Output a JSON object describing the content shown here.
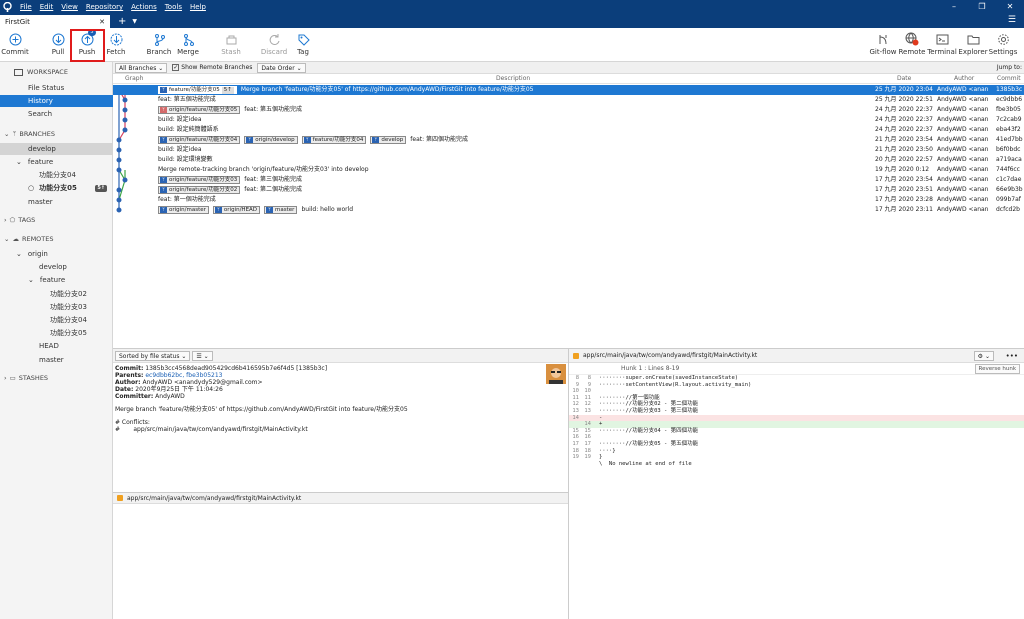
{
  "menu": {
    "items": [
      "File",
      "Edit",
      "View",
      "Repository",
      "Actions",
      "Tools",
      "Help"
    ]
  },
  "window": {
    "minimize": "–",
    "maximize": "❐",
    "close": "✕"
  },
  "tabs": [
    {
      "label": "FirstGit",
      "close": "✕"
    }
  ],
  "toolbar": {
    "commit": "Commit",
    "pull": "Pull",
    "push": "Push",
    "push_badge": "5",
    "fetch": "Fetch",
    "branch": "Branch",
    "merge": "Merge",
    "stash": "Stash",
    "discard": "Discard",
    "tag": "Tag",
    "gitflow": "Git-flow",
    "remote": "Remote",
    "terminal": "Terminal",
    "explorer": "Explorer",
    "settings": "Settings"
  },
  "sidebar": {
    "workspace": "WORKSPACE",
    "file_status": "File Status",
    "history": "History",
    "search": "Search",
    "branches": "BRANCHES",
    "develop": "develop",
    "feature": "feature",
    "f04": "功能分支04",
    "f05": "功能分支05",
    "f05_ahead": "5↑",
    "master": "master",
    "tags": "TAGS",
    "remotes": "REMOTES",
    "origin": "origin",
    "r_develop": "develop",
    "r_feature": "feature",
    "r_f02": "功能分支02",
    "r_f03": "功能分支03",
    "r_f04": "功能分支04",
    "r_f05": "功能分支05",
    "r_head": "HEAD",
    "r_master": "master",
    "stashes": "STASHES"
  },
  "filters": {
    "branches": "All Branches ⌄",
    "show_remote": "Show Remote Branches",
    "order": "Date Order ⌄",
    "jump": "Jump to:"
  },
  "columns": {
    "graph": "Graph",
    "description": "Description",
    "date": "Date",
    "author": "Author",
    "commit": "Commit"
  },
  "commits": [
    {
      "tags": [
        {
          "name": "feature/功能分支05",
          "cur": true,
          "ahead": "5↑"
        }
      ],
      "msg": "Merge branch 'feature/功能分支05' of https://github.com/AndyAWD/FirstGit into feature/功能分支05",
      "date": "25 九月 2020 23:04",
      "author": "AndyAWD <anan",
      "commit": "1385b3c"
    },
    {
      "tags": [],
      "msg": "feat: 第五個功能完成",
      "date": "25 九月 2020 22:51",
      "author": "AndyAWD <anan",
      "commit": "ec9dbb6"
    },
    {
      "tags": [
        {
          "name": "origin/feature/功能分支05",
          "remote": true
        }
      ],
      "msg": "feat: 第五個功能完成",
      "date": "24 九月 2020 22:37",
      "author": "AndyAWD <anan",
      "commit": "fbe3b05"
    },
    {
      "tags": [],
      "msg": "build: 設定idea",
      "date": "24 九月 2020 22:37",
      "author": "AndyAWD <anan",
      "commit": "7c2cab9"
    },
    {
      "tags": [],
      "msg": "build: 設定純簡體語系",
      "date": "24 九月 2020 22:37",
      "author": "AndyAWD <anan",
      "commit": "eba43f2"
    },
    {
      "tags": [
        {
          "name": "origin/feature/功能分支04"
        },
        {
          "name": "origin/develop"
        },
        {
          "name": "feature/功能分支04"
        },
        {
          "name": "develop"
        }
      ],
      "msg": "feat: 第四個功能完成",
      "date": "21 九月 2020 23:54",
      "author": "AndyAWD <anan",
      "commit": "41ed7bb"
    },
    {
      "tags": [],
      "msg": "build: 設定idea",
      "date": "21 九月 2020 23:50",
      "author": "AndyAWD <anan",
      "commit": "b6f0bdc"
    },
    {
      "tags": [],
      "msg": "build: 設定環境變數",
      "date": "20 九月 2020 22:57",
      "author": "AndyAWD <anan",
      "commit": "a719aca"
    },
    {
      "tags": [],
      "msg": "Merge remote-tracking branch 'origin/feature/功能分支03' into develop",
      "date": "19 九月 2020 0:12",
      "author": "AndyAWD <anan",
      "commit": "744f6cc"
    },
    {
      "tags": [
        {
          "name": "origin/feature/功能分支03"
        }
      ],
      "msg": "feat: 第三個功能完成",
      "date": "17 九月 2020 23:54",
      "author": "AndyAWD <anan",
      "commit": "c1c7dae"
    },
    {
      "tags": [
        {
          "name": "origin/feature/功能分支02"
        }
      ],
      "msg": "feat: 第二個功能完成",
      "date": "17 九月 2020 23:51",
      "author": "AndyAWD <anan",
      "commit": "66e9b3b"
    },
    {
      "tags": [],
      "msg": "feat: 第一個功能完成",
      "date": "17 九月 2020 23:28",
      "author": "AndyAWD <anan",
      "commit": "099b7af"
    },
    {
      "tags": [
        {
          "name": "origin/master"
        },
        {
          "name": "origin/HEAD"
        },
        {
          "name": "master"
        }
      ],
      "msg": "build: hello world",
      "date": "17 九月 2020 23:11",
      "author": "AndyAWD <anan",
      "commit": "dcfcd2b"
    }
  ],
  "details": {
    "sort": "Sorted by file status ⌄",
    "view": "☰ ⌄",
    "commit_label": "Commit:",
    "commit_val": "1385b3cc4568dead905429cd6b416595b7e6f4d5 [1385b3c]",
    "parents_label": "Parents:",
    "parents_val": "ec9dbb62bc, fbe3b05213",
    "author_label": "Author:",
    "author_val": "AndyAWD <anandydy529@gmail.com>",
    "date_label": "Date:",
    "date_val": "2020年9月25日 下午 11:04:26",
    "committer_label": "Committer:",
    "committer_val": "AndyAWD",
    "message": "Merge branch 'feature/功能分支05' of https://github.com/AndyAWD/FirstGit into feature/功能分支05",
    "conflicts": "# Conflicts:",
    "conflict_file": "#       app/src/main/java/tw/com/andyawd/firstgit/MainActivity.kt",
    "file": "app/src/main/java/tw/com/andyawd/firstgit/MainActivity.kt"
  },
  "diff": {
    "file": "app/src/main/java/tw/com/andyawd/firstgit/MainActivity.kt",
    "hunk": "Hunk 1 : Lines 8-19",
    "reverse": "Reverse hunk",
    "more": "•••",
    "lines": [
      {
        "n1": "8",
        "n2": "8",
        "code": "········super.onCreate(savedInstanceState)",
        "t": ""
      },
      {
        "n1": "9",
        "n2": "9",
        "code": "········setContentView(R.layout.activity_main)",
        "t": ""
      },
      {
        "n1": "10",
        "n2": "10",
        "code": "",
        "t": ""
      },
      {
        "n1": "11",
        "n2": "11",
        "code": "········//第一個功能",
        "t": ""
      },
      {
        "n1": "12",
        "n2": "12",
        "code": "········//功能分支02 - 第二個功能",
        "t": ""
      },
      {
        "n1": "13",
        "n2": "13",
        "code": "········//功能分支03 - 第三個功能",
        "t": ""
      },
      {
        "n1": "14",
        "n2": "",
        "code": "-",
        "t": "del"
      },
      {
        "n1": "",
        "n2": "14",
        "code": "+",
        "t": "add"
      },
      {
        "n1": "15",
        "n2": "15",
        "code": "········//功能分支04 - 第四個功能",
        "t": ""
      },
      {
        "n1": "16",
        "n2": "16",
        "code": "",
        "t": ""
      },
      {
        "n1": "17",
        "n2": "17",
        "code": "········//功能分支05 - 第五個功能",
        "t": ""
      },
      {
        "n1": "18",
        "n2": "18",
        "code": "····}",
        "t": ""
      },
      {
        "n1": "19",
        "n2": "19",
        "code": "}",
        "t": ""
      },
      {
        "n1": "",
        "n2": "",
        "code": "\\  No newline at end of file",
        "t": ""
      }
    ]
  }
}
